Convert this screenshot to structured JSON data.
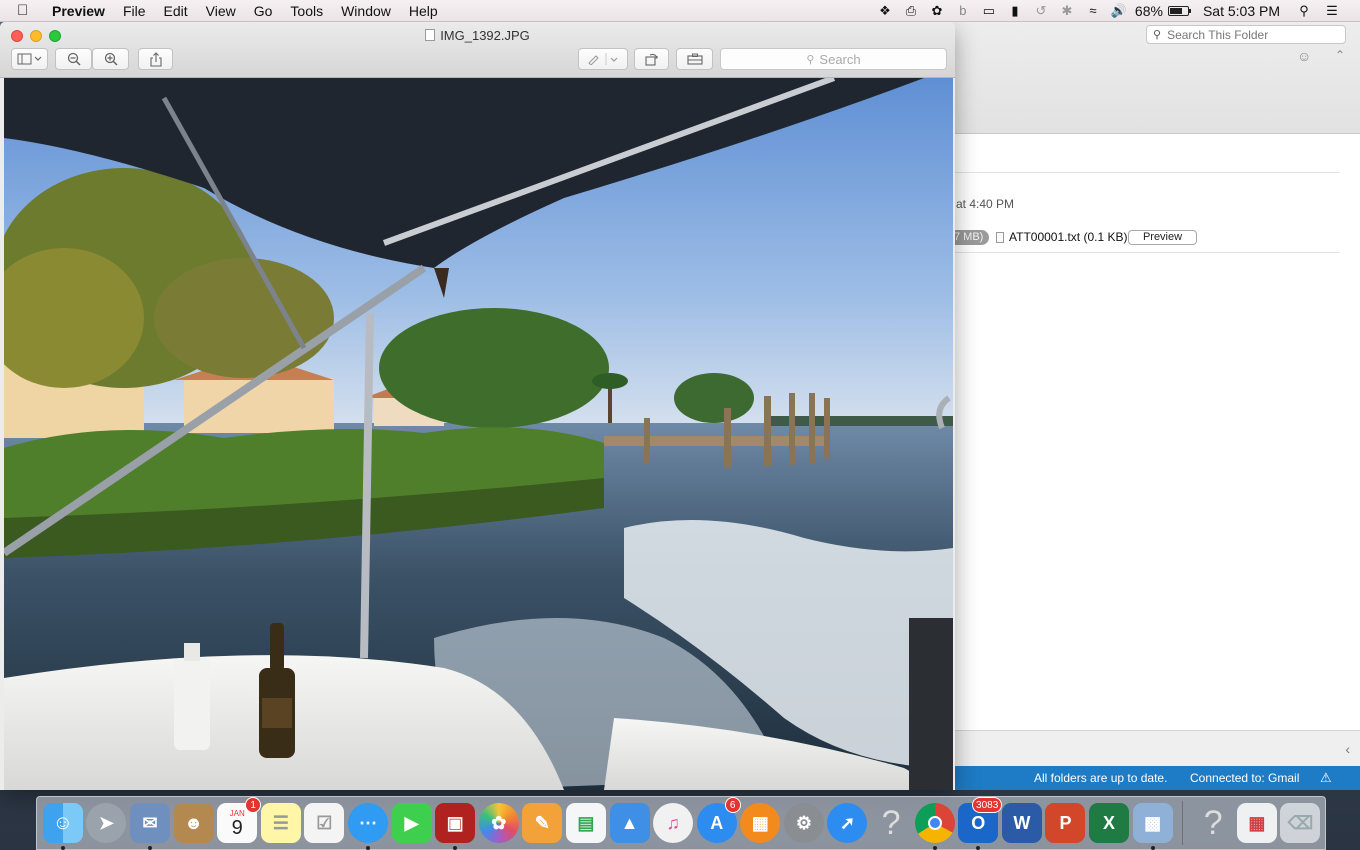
{
  "menubar": {
    "app_name": "Preview",
    "menus": [
      "File",
      "Edit",
      "View",
      "Go",
      "Tools",
      "Window",
      "Help"
    ],
    "battery_percent": "68%",
    "clock": "Sat 5:03 PM",
    "status_icons": [
      "dropbox-icon",
      "printer-icon",
      "bluetooth-app-icon",
      "beats-icon",
      "airplay-icon",
      "battery-icon",
      "time-machine-icon",
      "bluetooth-icon",
      "wifi-icon",
      "volume-icon"
    ]
  },
  "preview": {
    "title": "IMG_1392.JPG",
    "search_placeholder": "Search",
    "toolbar_icons": [
      "sidebar-toggle-icon",
      "zoom-out-icon",
      "zoom-in-icon",
      "share-icon",
      "markup-pen-icon",
      "rotate-icon",
      "toolbox-icon"
    ]
  },
  "mail": {
    "search_placeholder": "Search This Folder",
    "time_text": "at 4:40 PM",
    "size_pill": "7 MB)",
    "attachment_name": "ATT00001.txt (0.1 KB)",
    "preview_button": "Preview",
    "status_sync": "All folders are up to date.",
    "status_account": "Connected to: Gmail"
  },
  "dock": {
    "calendar_month": "JAN",
    "calendar_day": "9",
    "calendar_badge": "1",
    "appstore_badge": "6",
    "outlook_badge": "3083",
    "items": [
      "finder",
      "launchpad",
      "mail-stamp",
      "contacts",
      "calendar",
      "notes",
      "reminders",
      "messages",
      "facetime",
      "photo-booth",
      "photos",
      "pages",
      "numbers",
      "keynote",
      "itunes",
      "app-store",
      "ibooks",
      "system-preferences",
      "safari",
      "unknown-app",
      "chrome",
      "outlook",
      "word",
      "powerpoint",
      "excel",
      "preview",
      "unknown-app",
      "photo-slideshow",
      "trash"
    ]
  },
  "colors": {
    "mail_status_bar": "#1e7bc6",
    "badge_red": "#e3342f"
  }
}
